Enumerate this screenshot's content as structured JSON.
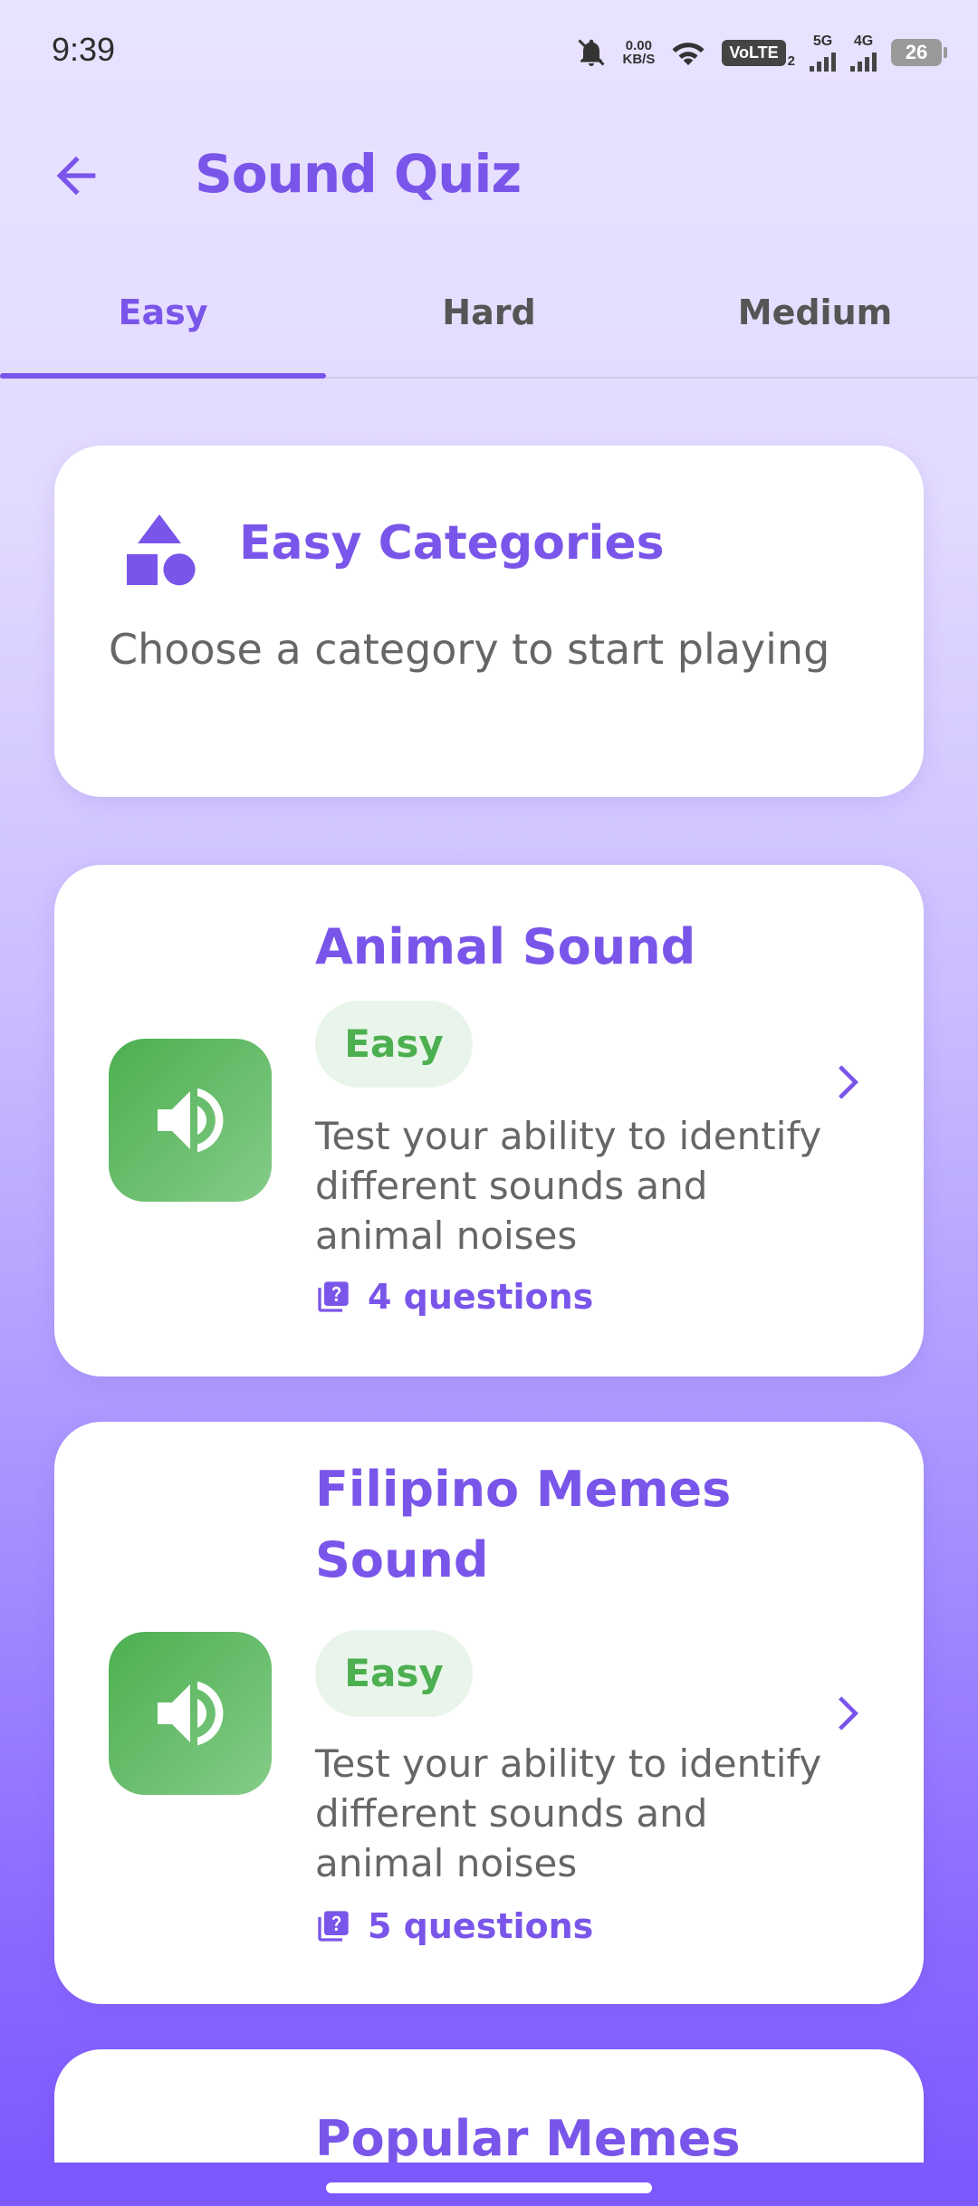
{
  "status": {
    "time": "9:39",
    "net_speed_value": "0.00",
    "net_speed_unit": "KB/S",
    "volte": "VoLTE",
    "volte_sub": "2",
    "sig1": "5G",
    "sig2": "4G",
    "battery": "26"
  },
  "appbar": {
    "title": "Sound Quiz"
  },
  "tabs": [
    {
      "label": "Easy",
      "active": true
    },
    {
      "label": "Hard",
      "active": false
    },
    {
      "label": "Medium",
      "active": false
    }
  ],
  "header_card": {
    "title": "Easy Categories",
    "subtitle": "Choose a category to start playing",
    "icon": "shapes-icon"
  },
  "categories": [
    {
      "title": "Animal Sound",
      "difficulty": "Easy",
      "description": "Test your ability to identify different sounds and animal noises",
      "questions": "4 questions"
    },
    {
      "title": "Filipino Memes Sound",
      "difficulty": "Easy",
      "description": "Test your ability to identify different sounds and animal noises",
      "questions": "5 questions"
    },
    {
      "title": "Popular Memes"
    }
  ],
  "colors": {
    "accent": "#7a55ea",
    "easy_green": "#4caf50",
    "badge_bg": "#e9f5ea"
  }
}
